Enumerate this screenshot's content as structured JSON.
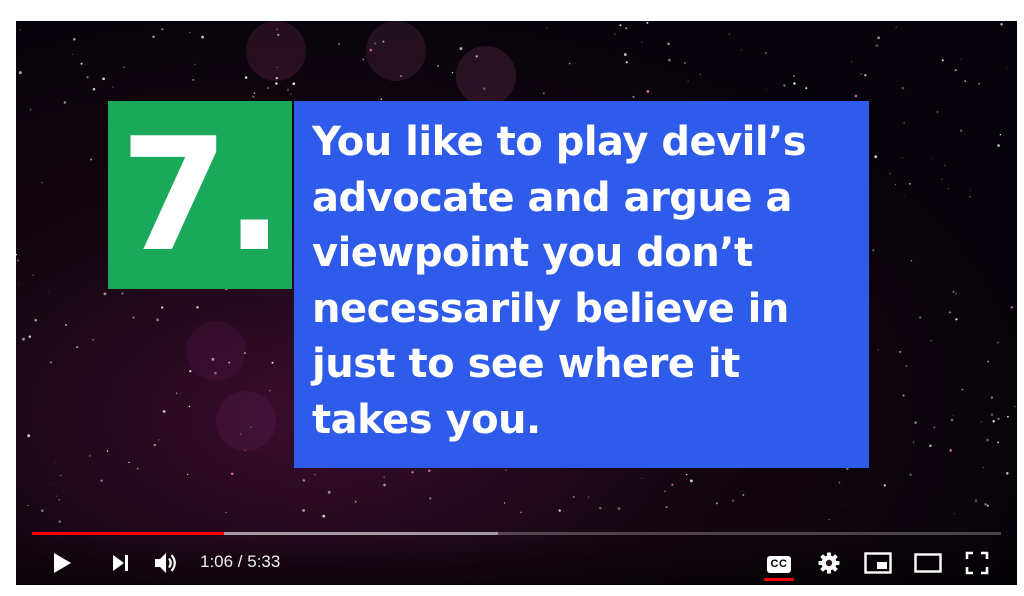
{
  "slide": {
    "number": "7.",
    "lines": [
      "You like to play devil’s",
      "advocate and argue a",
      "viewpoint you don’t",
      "necessarily believe in",
      "just to see where it",
      "takes you."
    ],
    "number_bg": "#1aa95a",
    "text_bg": "#2f5bea"
  },
  "player": {
    "time_display": "1:06 / 5:33",
    "progress_played": 0.198,
    "progress_buffered": 0.481,
    "accent": "#ff0000"
  },
  "controls": {
    "play": "play-icon",
    "next": "next-icon",
    "volume": "volume-icon",
    "captions": "CC",
    "settings": "gear-icon",
    "miniplayer": "miniplayer-icon",
    "theater": "theater-icon",
    "fullscreen": "fullscreen-icon"
  }
}
